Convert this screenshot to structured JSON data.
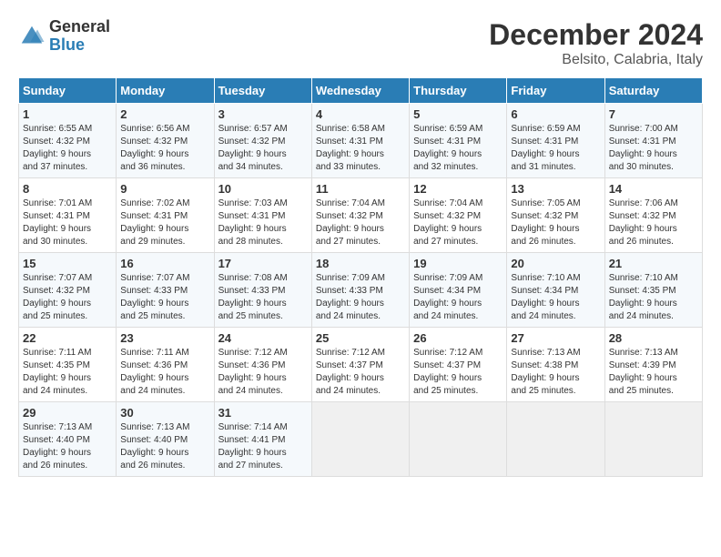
{
  "header": {
    "logo_general": "General",
    "logo_blue": "Blue",
    "title": "December 2024",
    "subtitle": "Belsito, Calabria, Italy"
  },
  "calendar": {
    "days_of_week": [
      "Sunday",
      "Monday",
      "Tuesday",
      "Wednesday",
      "Thursday",
      "Friday",
      "Saturday"
    ],
    "weeks": [
      [
        {
          "day": "",
          "info": ""
        },
        {
          "day": "",
          "info": ""
        },
        {
          "day": "",
          "info": ""
        },
        {
          "day": "",
          "info": ""
        },
        {
          "day": "",
          "info": ""
        },
        {
          "day": "",
          "info": ""
        },
        {
          "day": "",
          "info": ""
        }
      ],
      [
        {
          "day": "1",
          "info": "Sunrise: 6:55 AM\nSunset: 4:32 PM\nDaylight: 9 hours\nand 37 minutes."
        },
        {
          "day": "2",
          "info": "Sunrise: 6:56 AM\nSunset: 4:32 PM\nDaylight: 9 hours\nand 36 minutes."
        },
        {
          "day": "3",
          "info": "Sunrise: 6:57 AM\nSunset: 4:32 PM\nDaylight: 9 hours\nand 34 minutes."
        },
        {
          "day": "4",
          "info": "Sunrise: 6:58 AM\nSunset: 4:31 PM\nDaylight: 9 hours\nand 33 minutes."
        },
        {
          "day": "5",
          "info": "Sunrise: 6:59 AM\nSunset: 4:31 PM\nDaylight: 9 hours\nand 32 minutes."
        },
        {
          "day": "6",
          "info": "Sunrise: 6:59 AM\nSunset: 4:31 PM\nDaylight: 9 hours\nand 31 minutes."
        },
        {
          "day": "7",
          "info": "Sunrise: 7:00 AM\nSunset: 4:31 PM\nDaylight: 9 hours\nand 30 minutes."
        }
      ],
      [
        {
          "day": "8",
          "info": "Sunrise: 7:01 AM\nSunset: 4:31 PM\nDaylight: 9 hours\nand 30 minutes."
        },
        {
          "day": "9",
          "info": "Sunrise: 7:02 AM\nSunset: 4:31 PM\nDaylight: 9 hours\nand 29 minutes."
        },
        {
          "day": "10",
          "info": "Sunrise: 7:03 AM\nSunset: 4:31 PM\nDaylight: 9 hours\nand 28 minutes."
        },
        {
          "day": "11",
          "info": "Sunrise: 7:04 AM\nSunset: 4:32 PM\nDaylight: 9 hours\nand 27 minutes."
        },
        {
          "day": "12",
          "info": "Sunrise: 7:04 AM\nSunset: 4:32 PM\nDaylight: 9 hours\nand 27 minutes."
        },
        {
          "day": "13",
          "info": "Sunrise: 7:05 AM\nSunset: 4:32 PM\nDaylight: 9 hours\nand 26 minutes."
        },
        {
          "day": "14",
          "info": "Sunrise: 7:06 AM\nSunset: 4:32 PM\nDaylight: 9 hours\nand 26 minutes."
        }
      ],
      [
        {
          "day": "15",
          "info": "Sunrise: 7:07 AM\nSunset: 4:32 PM\nDaylight: 9 hours\nand 25 minutes."
        },
        {
          "day": "16",
          "info": "Sunrise: 7:07 AM\nSunset: 4:33 PM\nDaylight: 9 hours\nand 25 minutes."
        },
        {
          "day": "17",
          "info": "Sunrise: 7:08 AM\nSunset: 4:33 PM\nDaylight: 9 hours\nand 25 minutes."
        },
        {
          "day": "18",
          "info": "Sunrise: 7:09 AM\nSunset: 4:33 PM\nDaylight: 9 hours\nand 24 minutes."
        },
        {
          "day": "19",
          "info": "Sunrise: 7:09 AM\nSunset: 4:34 PM\nDaylight: 9 hours\nand 24 minutes."
        },
        {
          "day": "20",
          "info": "Sunrise: 7:10 AM\nSunset: 4:34 PM\nDaylight: 9 hours\nand 24 minutes."
        },
        {
          "day": "21",
          "info": "Sunrise: 7:10 AM\nSunset: 4:35 PM\nDaylight: 9 hours\nand 24 minutes."
        }
      ],
      [
        {
          "day": "22",
          "info": "Sunrise: 7:11 AM\nSunset: 4:35 PM\nDaylight: 9 hours\nand 24 minutes."
        },
        {
          "day": "23",
          "info": "Sunrise: 7:11 AM\nSunset: 4:36 PM\nDaylight: 9 hours\nand 24 minutes."
        },
        {
          "day": "24",
          "info": "Sunrise: 7:12 AM\nSunset: 4:36 PM\nDaylight: 9 hours\nand 24 minutes."
        },
        {
          "day": "25",
          "info": "Sunrise: 7:12 AM\nSunset: 4:37 PM\nDaylight: 9 hours\nand 24 minutes."
        },
        {
          "day": "26",
          "info": "Sunrise: 7:12 AM\nSunset: 4:37 PM\nDaylight: 9 hours\nand 25 minutes."
        },
        {
          "day": "27",
          "info": "Sunrise: 7:13 AM\nSunset: 4:38 PM\nDaylight: 9 hours\nand 25 minutes."
        },
        {
          "day": "28",
          "info": "Sunrise: 7:13 AM\nSunset: 4:39 PM\nDaylight: 9 hours\nand 25 minutes."
        }
      ],
      [
        {
          "day": "29",
          "info": "Sunrise: 7:13 AM\nSunset: 4:40 PM\nDaylight: 9 hours\nand 26 minutes."
        },
        {
          "day": "30",
          "info": "Sunrise: 7:13 AM\nSunset: 4:40 PM\nDaylight: 9 hours\nand 26 minutes."
        },
        {
          "day": "31",
          "info": "Sunrise: 7:14 AM\nSunset: 4:41 PM\nDaylight: 9 hours\nand 27 minutes."
        },
        {
          "day": "",
          "info": ""
        },
        {
          "day": "",
          "info": ""
        },
        {
          "day": "",
          "info": ""
        },
        {
          "day": "",
          "info": ""
        }
      ]
    ]
  }
}
